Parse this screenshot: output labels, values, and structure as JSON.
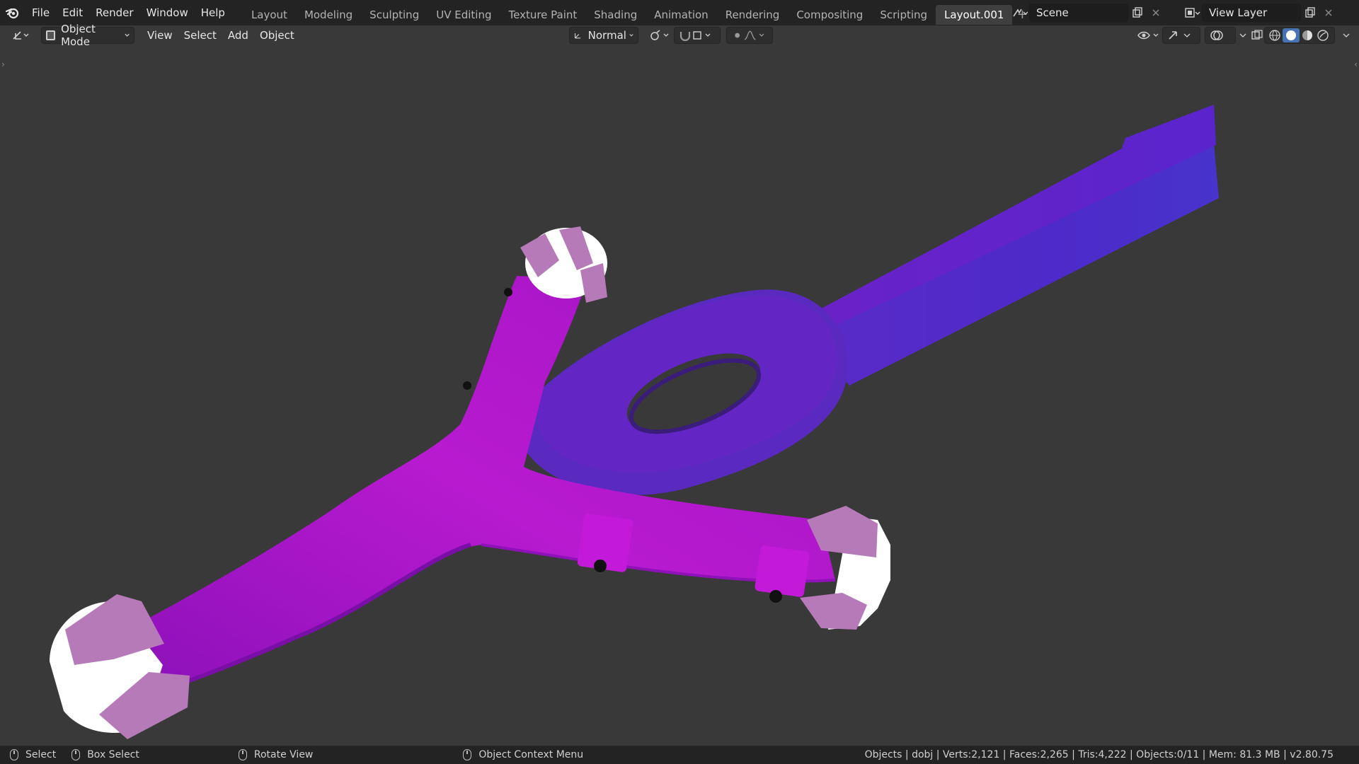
{
  "topbar": {
    "menus": [
      "File",
      "Edit",
      "Render",
      "Window",
      "Help"
    ],
    "workspaces": [
      "Layout",
      "Modeling",
      "Sculpting",
      "UV Editing",
      "Texture Paint",
      "Shading",
      "Animation",
      "Rendering",
      "Compositing",
      "Scripting",
      "Layout.001"
    ],
    "active_workspace": "Layout.001",
    "add_workspace": "+",
    "scene": "Scene",
    "view_layer": "View Layer"
  },
  "viewport_header": {
    "mode": "Object Mode",
    "menus": [
      "View",
      "Select",
      "Add",
      "Object"
    ],
    "orientation": "Normal"
  },
  "statusbar": {
    "select": "Select",
    "box_select": "Box Select",
    "rotate_view": "Rotate View",
    "context_menu": "Object Context Menu",
    "stats": "Objects | dobj | Verts:2,121 | Faces:2,265 | Tris:4,222 | Objects:0/11 | Mem: 81.3 MB | v2.80.75"
  },
  "colors": {
    "topbar_bg": "#232323",
    "viewport_bg": "#393939",
    "mesh_magenta": "#b21bd0",
    "mesh_blue": "#5a2fd0",
    "mesh_wheel_white": "#ffffff"
  }
}
